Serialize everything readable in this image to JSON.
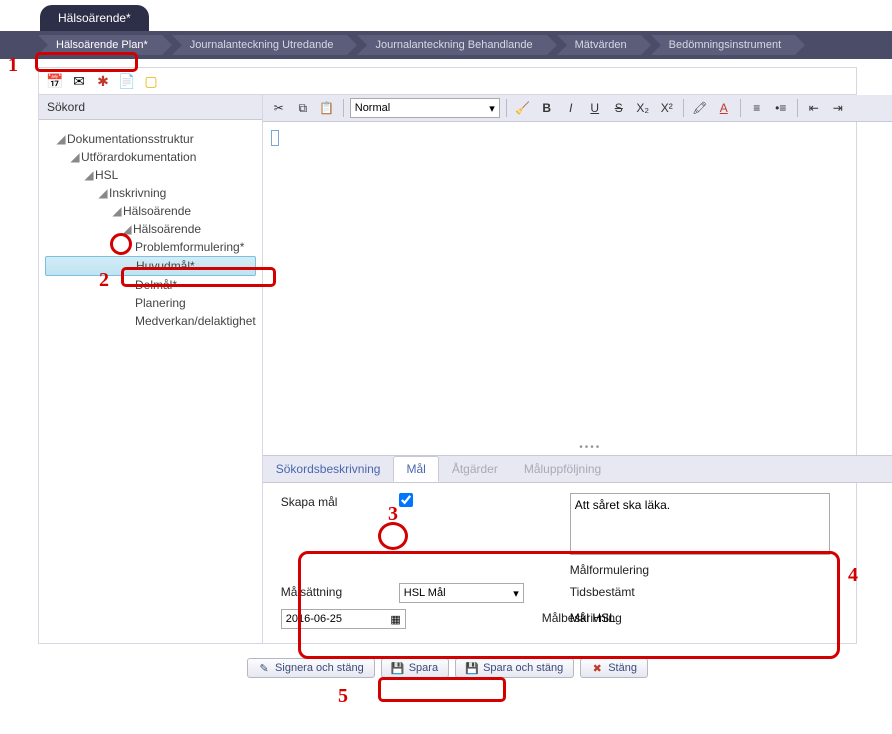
{
  "main_tab": "Hälsoärende*",
  "breadcrumbs": [
    {
      "label": "Hälsoärende Plan*",
      "active": true
    },
    {
      "label": "Journalanteckning Utredande"
    },
    {
      "label": "Journalanteckning Behandlande"
    },
    {
      "label": "Mätvärden"
    },
    {
      "label": "Bedömningsinstrument"
    }
  ],
  "left_panel_title": "Sökord",
  "tree": {
    "n0": "Dokumentationsstruktur",
    "n1": "Utförardokumentation",
    "n2": "HSL",
    "n3": "Inskrivning",
    "n4": "Hälsoärende",
    "n5": "Hälsoärende",
    "n6": "Problemformulering*",
    "n7": "Huvudmål*",
    "n8": "Delmål*",
    "n9": "Planering",
    "n10": "Medverkan/delaktighet"
  },
  "editor": {
    "format_value": "Normal"
  },
  "subtabs": {
    "t1": "Sökordsbeskrivning",
    "t2": "Mål",
    "t3": "Åtgärder",
    "t4": "Måluppföljning"
  },
  "form": {
    "skapa_label": "Skapa mål",
    "skapa_checked": true,
    "malsattning_label": "Målsättning",
    "malsattning_value": "HSL Mål",
    "tidsbestamt_label": "Tidsbestämt",
    "tidsbestamt_value": "2016-06-25",
    "malbeskrivning_label": "Målbeskrivning",
    "malbeskrivning_value": "Mål HSL",
    "malformulering_label": "Målformulering",
    "malformulering_value": "Att såret ska läka."
  },
  "buttons": {
    "signera": "Signera och stäng",
    "spara": "Spara",
    "spara_stang": "Spara och stäng",
    "stang": "Stäng"
  },
  "annotations": {
    "a1": "1",
    "a2": "2",
    "a3": "3",
    "a4": "4",
    "a5": "5"
  }
}
